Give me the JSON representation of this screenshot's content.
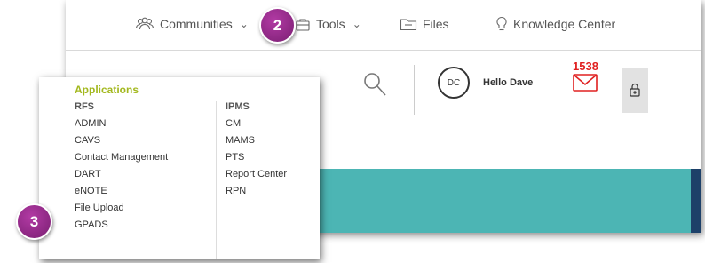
{
  "nav": {
    "communities": "Communities",
    "tools": "Tools",
    "files": "Files",
    "knowledge_center": "Knowledge Center"
  },
  "header": {
    "avatar_initials": "DC",
    "greeting": "Hello Dave",
    "notification_count": "1538"
  },
  "dropdown": {
    "title": "Applications",
    "left_heading": "RFS",
    "left_items": [
      "ADMIN",
      "CAVS",
      "Contact Management",
      "DART",
      "eNOTE",
      "File Upload",
      "GPADS"
    ],
    "right_heading": "IPMS",
    "right_items": [
      "CM",
      "MAMS",
      "PTS",
      "Report Center",
      "RPN"
    ]
  },
  "badges": {
    "step2": "2",
    "step3": "3"
  },
  "colors": {
    "accent_title": "#a3b81e",
    "badge": "#8e2a85",
    "band": "#4cb5b4",
    "band_dark": "#1d4069",
    "alert": "#e02020"
  }
}
